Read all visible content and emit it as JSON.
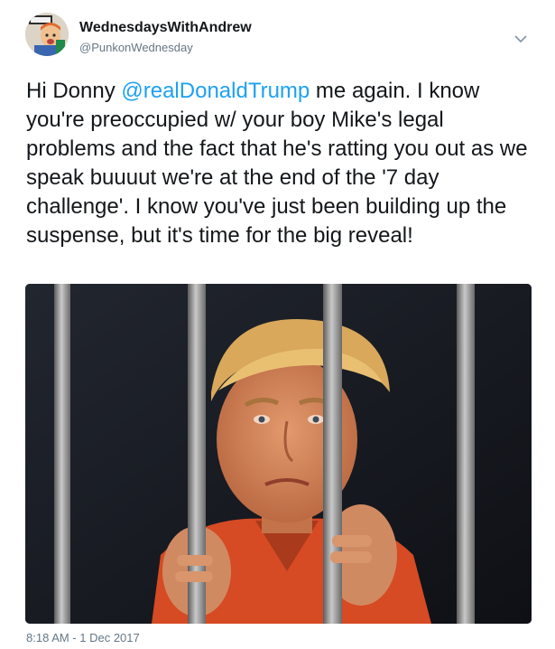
{
  "tweet": {
    "author": {
      "display_name": "WednesdaysWithAndrew",
      "handle": "@PunkonWednesday"
    },
    "text": {
      "intro": "Hi Donny ",
      "mention": "@realDonaldTrump",
      "body": " me again. I know you're preoccupied w/ your boy Mike's legal problems and the fact that he's ratting you out as we speak buuuut we're at the end of the '7 day challenge'. I know you've just been building up the suspense, but it's time for the big reveal!"
    },
    "timestamp": "8:18 AM - 1 Dec 2017",
    "icons": {
      "menu": "chevron-down-icon"
    },
    "colors": {
      "link": "#1da1f2",
      "secondary_text": "#657786",
      "primary_text": "#14171a"
    }
  }
}
